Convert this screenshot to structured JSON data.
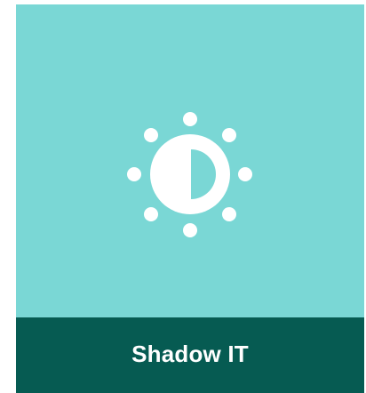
{
  "tile": {
    "icon": "brightness-contrast-icon",
    "caption": "Shadow IT"
  },
  "colors": {
    "tile_background": "#7ad7d5",
    "caption_bar": "#065b52",
    "icon": "#ffffff",
    "caption_text": "#ffffff"
  }
}
